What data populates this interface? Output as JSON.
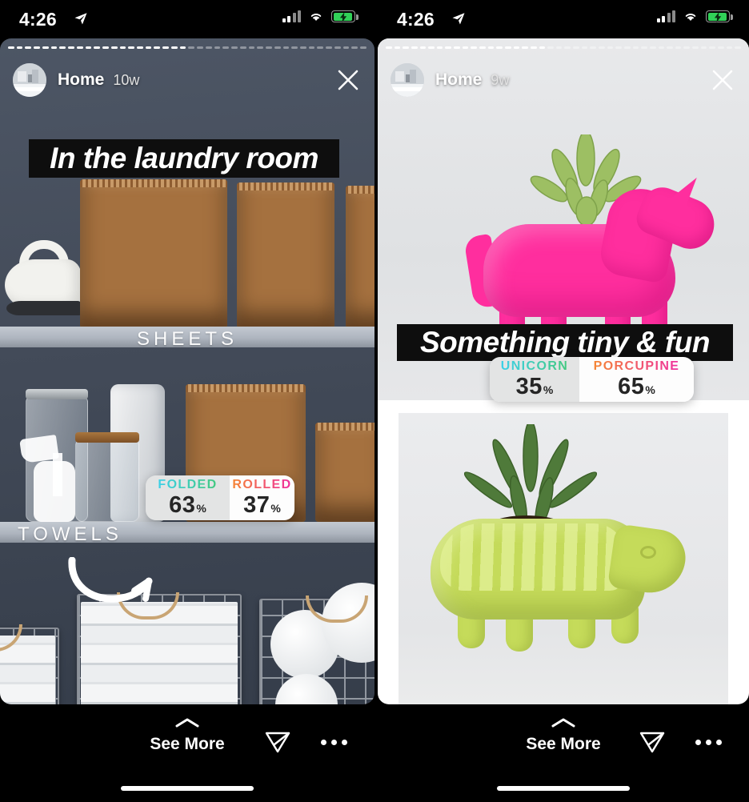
{
  "screens": [
    {
      "status": {
        "time": "4:26",
        "location_icon": "location-arrow-icon",
        "signal_icon": "cellular-signal-icon",
        "wifi_icon": "wifi-icon",
        "battery_icon": "battery-charging-icon"
      },
      "header": {
        "username": "Home",
        "timestamp": "10w",
        "avatar": "profile-avatar",
        "close_label": "close-icon",
        "segments_total": 42,
        "segments_seen": 21
      },
      "banner": {
        "text": "In the laundry room"
      },
      "photo_labels": {
        "top_shelf": "SHEETS",
        "bottom_shelf": "TOWELS"
      },
      "poll": {
        "options": [
          {
            "label": "FOLDED",
            "percent": "63",
            "symbol": "%"
          },
          {
            "label": "ROLLED",
            "percent": "37",
            "symbol": "%"
          }
        ]
      },
      "bottom": {
        "see_more": "See More",
        "chevron_icon": "chevron-up-icon",
        "send_icon": "send-message-icon",
        "more_icon": "more-options-icon"
      }
    },
    {
      "status": {
        "time": "4:26",
        "location_icon": "location-arrow-icon",
        "signal_icon": "cellular-signal-icon",
        "wifi_icon": "wifi-icon",
        "battery_icon": "battery-charging-icon"
      },
      "header": {
        "username": "Home",
        "timestamp": "9w",
        "avatar": "profile-avatar",
        "close_label": "close-icon",
        "segments_total": 42,
        "segments_seen": 19
      },
      "banner": {
        "text": "Something tiny & fun"
      },
      "photo_labels": {
        "top_shelf": "",
        "bottom_shelf": ""
      },
      "poll": {
        "options": [
          {
            "label": "UNICORN",
            "percent": "35",
            "symbol": "%"
          },
          {
            "label": "PORCUPINE",
            "percent": "65",
            "symbol": "%"
          }
        ]
      },
      "bottom": {
        "see_more": "See More",
        "chevron_icon": "chevron-up-icon",
        "send_icon": "send-message-icon",
        "more_icon": "more-options-icon"
      }
    }
  ],
  "colors": {
    "poll_gradient_a_start": "#3dd0e8",
    "poll_gradient_a_end": "#44c97f",
    "poll_gradient_b_start": "#f58634",
    "poll_gradient_b_end": "#ef2fa0",
    "battery_green": "#31d158",
    "unicorn_pink": "#ff2e9e",
    "porcupine_green": "#c5db5a",
    "wall_slate": "#4a525e"
  }
}
